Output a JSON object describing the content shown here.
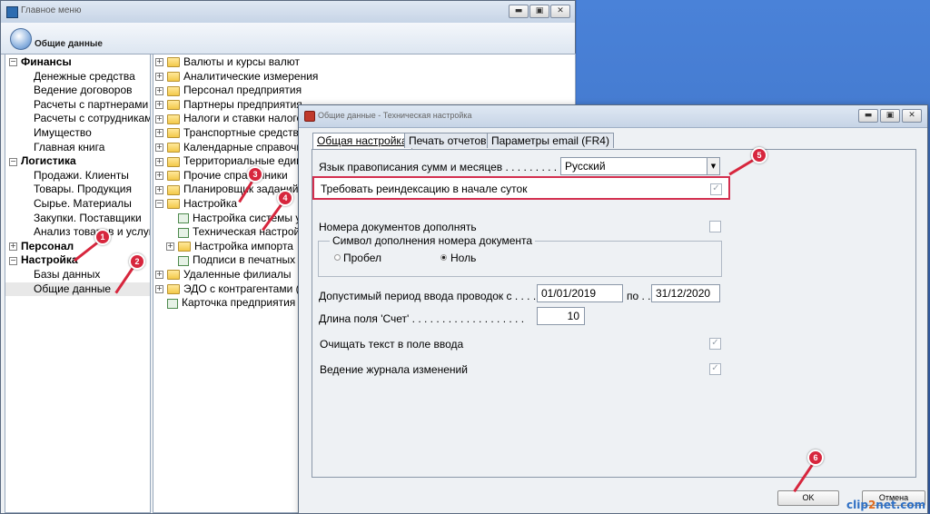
{
  "main_window": {
    "title": "Главное меню",
    "header_title": "Общие данные",
    "btn_min": "▬",
    "btn_max": "▣",
    "btn_close": "✕"
  },
  "left_tree": [
    {
      "label": "Финансы",
      "level": 0,
      "bold": true,
      "expander": "−"
    },
    {
      "label": "Денежные средства",
      "level": 1
    },
    {
      "label": "Ведение договоров",
      "level": 1
    },
    {
      "label": "Расчеты с партнерами",
      "level": 1
    },
    {
      "label": "Расчеты с сотрудниками",
      "level": 1
    },
    {
      "label": "Имущество",
      "level": 1
    },
    {
      "label": "Главная книга",
      "level": 1
    },
    {
      "label": "Логистика",
      "level": 0,
      "bold": true,
      "expander": "−"
    },
    {
      "label": "Продажи. Клиенты",
      "level": 1
    },
    {
      "label": "Товары. Продукция",
      "level": 1
    },
    {
      "label": "Сырье. Материалы",
      "level": 1
    },
    {
      "label": "Закупки. Поставщики",
      "level": 1
    },
    {
      "label": "Анализ товаров и услуг",
      "level": 1
    },
    {
      "label": "Персонал",
      "level": 0,
      "bold": true,
      "expander": "+"
    },
    {
      "label": "Настройка",
      "level": 0,
      "bold": true,
      "expander": "−"
    },
    {
      "label": "Базы данных",
      "level": 1
    },
    {
      "label": "Общие данные",
      "level": 1,
      "selected": true
    }
  ],
  "right_tree": [
    {
      "label": "Валюты и курсы валют",
      "type": "folder",
      "expander": "+"
    },
    {
      "label": "Аналитические измерения",
      "type": "folder",
      "expander": "+"
    },
    {
      "label": "Персонал предприятия",
      "type": "folder",
      "expander": "+"
    },
    {
      "label": "Партнеры предприятия",
      "type": "folder",
      "expander": "+"
    },
    {
      "label": "Налоги и ставки налогов",
      "type": "folder",
      "expander": "+"
    },
    {
      "label": "Транспортные средства",
      "type": "folder",
      "expander": "+"
    },
    {
      "label": "Календарные справочники",
      "type": "folder",
      "expander": "+"
    },
    {
      "label": "Территориальные единицы",
      "type": "folder",
      "expander": "+"
    },
    {
      "label": "Прочие справочники",
      "type": "folder",
      "expander": "+"
    },
    {
      "label": "Планировщик заданий",
      "type": "folder",
      "expander": "+"
    },
    {
      "label": "Настройка",
      "type": "folder",
      "expander": "−"
    },
    {
      "label": "Настройка системы у",
      "type": "doc",
      "indent": true
    },
    {
      "label": "Техническая настройка",
      "type": "doc",
      "indent": true
    },
    {
      "label": "Настройка импорта",
      "type": "folder",
      "expander": "+",
      "indent": true
    },
    {
      "label": "Подписи в печатных формах",
      "type": "doc",
      "indent": true
    },
    {
      "label": "Удаленные филиалы",
      "type": "folder",
      "expander": "+"
    },
    {
      "label": "ЭДО с контрагентами (Д",
      "type": "folder",
      "expander": "+"
    },
    {
      "label": "Карточка предприятия",
      "type": "doc"
    }
  ],
  "dialog": {
    "title": "Общие данные - Техническая настройка",
    "tabs": [
      "Общая настройка",
      "Печать отчетов",
      "Параметры email (FR4)"
    ],
    "spell_label": "Язык правописания сумм и месяцев . . . . . . . . . . .",
    "spell_value": "Русский",
    "reindex_label": "Требовать реиндексацию в начале суток",
    "reindex_checked": true,
    "docnum_label": "Номера документов дополнять",
    "docnum_checked": false,
    "group_title": "Символ дополнения номера документа",
    "radio_space": "Пробел",
    "radio_zero": "Ноль",
    "radio_selected": "zero",
    "period_label": "Допустимый период ввода проводок с  . . . .",
    "period_from": "01/01/2019",
    "period_to_label": "по . .",
    "period_to": "31/12/2020",
    "account_len_label": "Длина поля 'Счет' . . . . . . . . . . . . . . . . . . .",
    "account_len_value": "10",
    "clear_text_label": "Очищать текст в поле ввода",
    "clear_text_checked": true,
    "journal_label": "Ведение журнала изменений",
    "journal_checked": true,
    "ok": "OK",
    "cancel": "Отмена"
  },
  "markers": [
    "1",
    "2",
    "3",
    "4",
    "5",
    "6"
  ],
  "marker_color": "#d7263d",
  "watermark": {
    "part1": "clip",
    "part2": "2",
    "part3": "net.com"
  }
}
